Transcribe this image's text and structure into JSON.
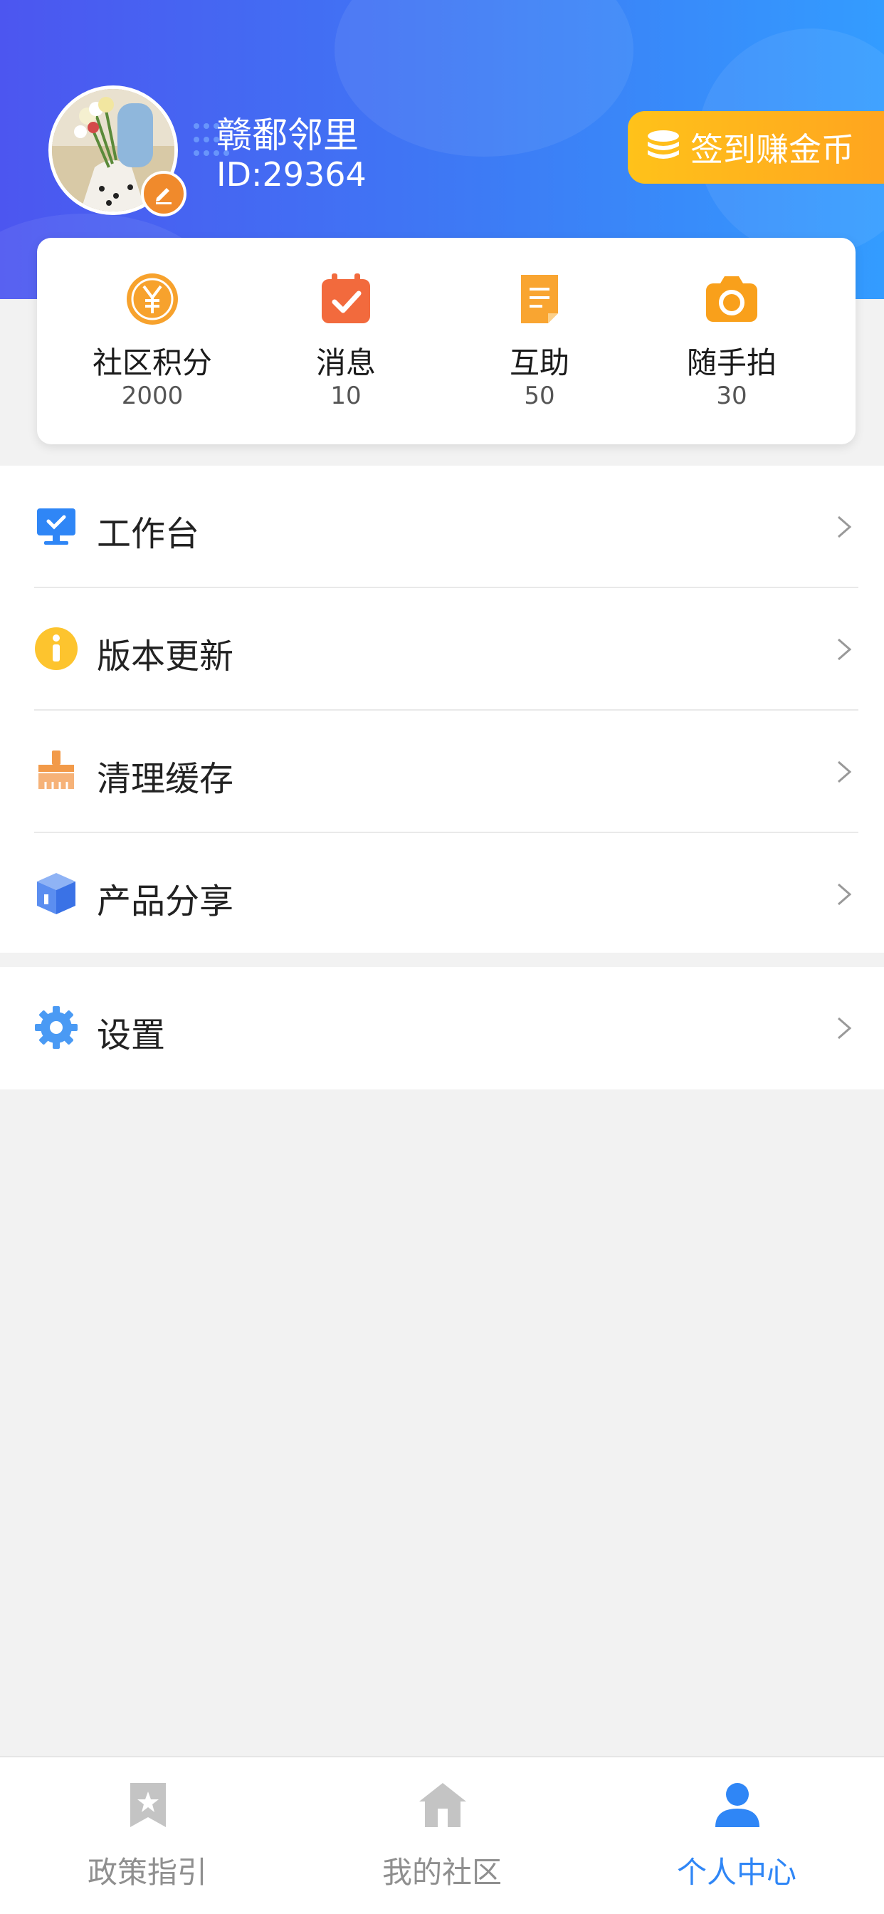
{
  "profile": {
    "name": "赣鄱邻里",
    "id_text": "ID:29364",
    "avatar_icon": "avatar-photo",
    "edit_icon": "edit-pencil-icon"
  },
  "checkin": {
    "label": "签到赚金币",
    "icon": "coins-stack-icon"
  },
  "stats": [
    {
      "label": "社区积分",
      "value": "2000",
      "icon": "yuan-coin-icon",
      "color": "#f7a22d"
    },
    {
      "label": "消息",
      "value": "10",
      "icon": "calendar-check-icon",
      "color": "#f26a3d"
    },
    {
      "label": "互助",
      "value": "50",
      "icon": "document-icon",
      "color": "#f9a531"
    },
    {
      "label": "随手拍",
      "value": "30",
      "icon": "camera-icon",
      "color": "#f9a01b"
    }
  ],
  "menu": [
    {
      "label": "工作台",
      "icon": "monitor-check-icon"
    },
    {
      "label": "版本更新",
      "icon": "info-icon"
    },
    {
      "label": "清理缓存",
      "icon": "broom-icon"
    },
    {
      "label": "产品分享",
      "icon": "box-icon"
    }
  ],
  "settings": {
    "label": "设置",
    "icon": "gear-icon"
  },
  "tabs": [
    {
      "label": "政策指引",
      "icon": "bookmark-star-icon",
      "active": false
    },
    {
      "label": "我的社区",
      "icon": "house-icon",
      "active": false
    },
    {
      "label": "个人中心",
      "icon": "person-icon",
      "active": true
    }
  ],
  "colors": {
    "header_start": "#4c56f0",
    "header_end": "#339cff",
    "checkin": "#ffb41d",
    "tab_active": "#2f86f6",
    "tab_inactive": "#8f8f8f"
  }
}
